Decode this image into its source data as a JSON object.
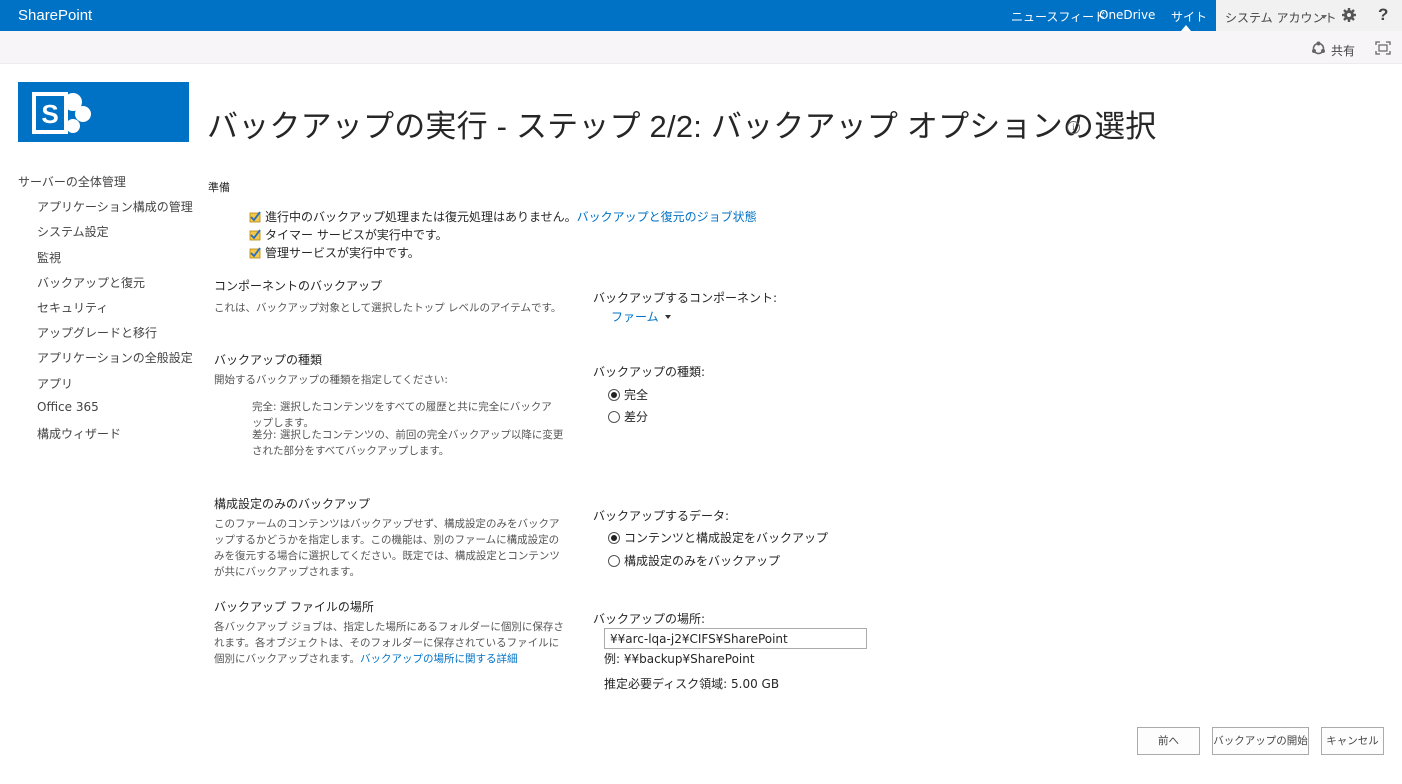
{
  "suite": {
    "brand": "SharePoint",
    "links": [
      "ニュースフィード",
      "OneDrive",
      "サイト"
    ],
    "account": "システム アカウント",
    "help": "?"
  },
  "ribbon": {
    "share_label": "共有"
  },
  "page": {
    "title": "バックアップの実行 - ステップ 2/2: バックアップ オプションの選択",
    "info": "i"
  },
  "nav": {
    "root": "サーバーの全体管理",
    "items": [
      "アプリケーション構成の管理",
      "システム設定",
      "監視",
      "バックアップと復元",
      "セキュリティ",
      "アップグレードと移行",
      "アプリケーションの全般設定",
      "アプリ",
      "Office 365",
      "構成ウィザード"
    ]
  },
  "prep": {
    "heading": "準備",
    "lines": [
      "進行中のバックアップ処理または復元処理はありません。",
      "タイマー サービスが実行中です。",
      "管理サービスが実行中です。"
    ],
    "job_link": "バックアップと復元のジョブ状態"
  },
  "component": {
    "heading": "コンポーネントのバックアップ",
    "desc": "これは、バックアップ対象として選択したトップ レベルのアイテムです。",
    "label": "バックアップするコンポーネント:",
    "value": "ファーム"
  },
  "type": {
    "heading": "バックアップの種類",
    "desc": "開始するバックアップの種類を指定してください:",
    "full_desc": "完全: 選択したコンテンツをすべての履歴と共に完全にバックアップします。",
    "diff_desc": "差分: 選択したコンテンツの、前回の完全バックアップ以降に変更された部分をすべてバックアップします。",
    "label": "バックアップの種類:",
    "options": [
      "完全",
      "差分"
    ],
    "selected": "完全"
  },
  "config": {
    "heading": "構成設定のみのバックアップ",
    "desc": "このファームのコンテンツはバックアップせず、構成設定のみをバックアップするかどうかを指定します。この機能は、別のファームに構成設定のみを復元する場合に選択してください。既定では、構成設定とコンテンツが共にバックアップされます。",
    "label": "バックアップするデータ:",
    "options": [
      "コンテンツと構成設定をバックアップ",
      "構成設定のみをバックアップ"
    ],
    "selected": "コンテンツと構成設定をバックアップ"
  },
  "location": {
    "heading": "バックアップ ファイルの場所",
    "desc": "各バックアップ ジョブは、指定した場所にあるフォルダーに個別に保存されます。各オブジェクトは、そのフォルダーに保存されているファイルに個別にバックアップされます。",
    "link": "バックアップの場所に関する詳細",
    "label": "バックアップの場所:",
    "value": "¥¥arc-lqa-j2¥CIFS¥SharePoint",
    "example": "例: ¥¥backup¥SharePoint",
    "disk": "推定必要ディスク領域: 5.00 GB"
  },
  "buttons": {
    "prev": "前へ",
    "start": "バックアップの開始",
    "cancel": "キャンセル"
  },
  "colors": {
    "suite": "#0072c6",
    "link": "#0072c6"
  }
}
